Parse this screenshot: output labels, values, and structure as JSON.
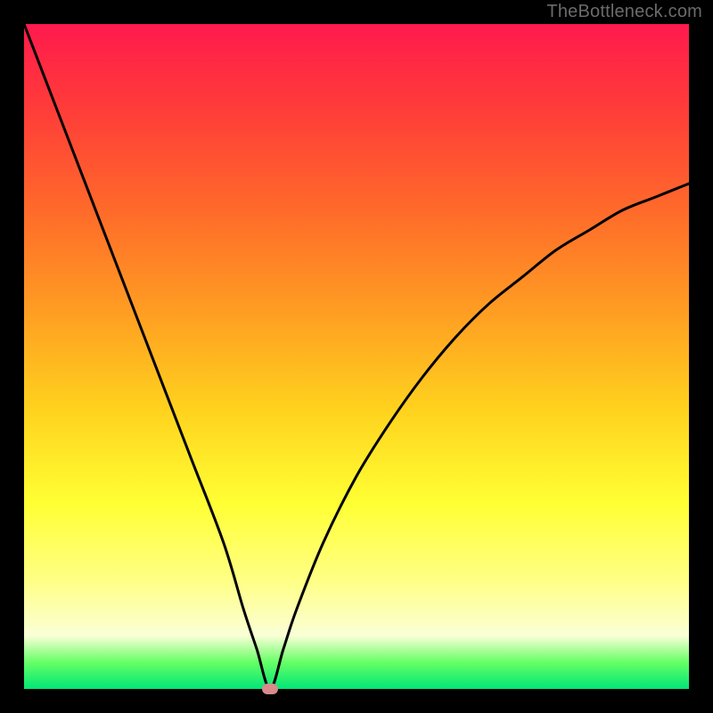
{
  "watermark": "TheBottleneck.com",
  "colors": {
    "frame_bg": "#000000",
    "gradient_top": "#ff1a4d",
    "gradient_bottom": "#00e676",
    "curve": "#000000",
    "marker": "#d98a8a"
  },
  "chart_data": {
    "type": "line",
    "title": "",
    "xlabel": "",
    "ylabel": "",
    "xlim": [
      0,
      100
    ],
    "ylim": [
      0,
      100
    ],
    "grid": false,
    "legend": false,
    "annotations": [
      "TheBottleneck.com"
    ],
    "marker": {
      "x": 37,
      "y": 0
    },
    "series": [
      {
        "name": "bottleneck-curve",
        "x": [
          0,
          5,
          10,
          15,
          20,
          25,
          30,
          33,
          35,
          37,
          39,
          41,
          45,
          50,
          55,
          60,
          65,
          70,
          75,
          80,
          85,
          90,
          95,
          100
        ],
        "values": [
          100,
          87,
          74,
          61,
          48,
          35,
          22,
          12,
          6,
          0,
          6,
          12,
          22,
          32,
          40,
          47,
          53,
          58,
          62,
          66,
          69,
          72,
          74,
          76
        ]
      }
    ]
  }
}
